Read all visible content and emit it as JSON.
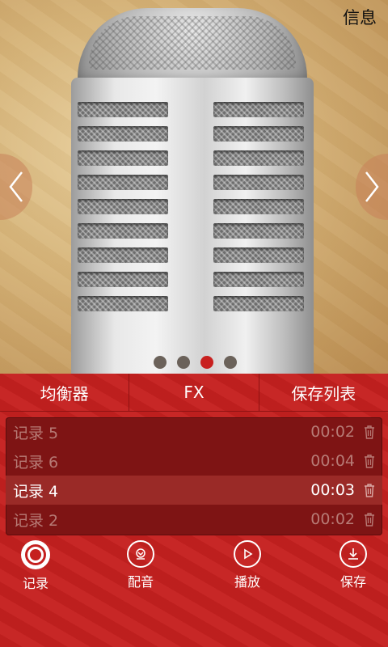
{
  "header": {
    "info_label": "信息"
  },
  "pager": {
    "count": 4,
    "active_index": 2
  },
  "tabs": [
    {
      "label": "均衡器"
    },
    {
      "label": "FX"
    },
    {
      "label": "保存列表"
    }
  ],
  "recordings": [
    {
      "name": "记录 5",
      "duration": "00:02",
      "selected": false
    },
    {
      "name": "记录 6",
      "duration": "00:04",
      "selected": false
    },
    {
      "name": "记录 4",
      "duration": "00:03",
      "selected": true
    },
    {
      "name": "记录 2",
      "duration": "00:02",
      "selected": false
    }
  ],
  "actions": [
    {
      "label": "记录",
      "icon": "record-icon"
    },
    {
      "label": "配音",
      "icon": "dub-icon"
    },
    {
      "label": "播放",
      "icon": "play-icon"
    },
    {
      "label": "保存",
      "icon": "download-icon"
    }
  ],
  "colors": {
    "accent_red": "#c5201f",
    "list_bg": "#7e1414",
    "selected_row": "#9a2a27",
    "dot_inactive": "#6b625a"
  }
}
